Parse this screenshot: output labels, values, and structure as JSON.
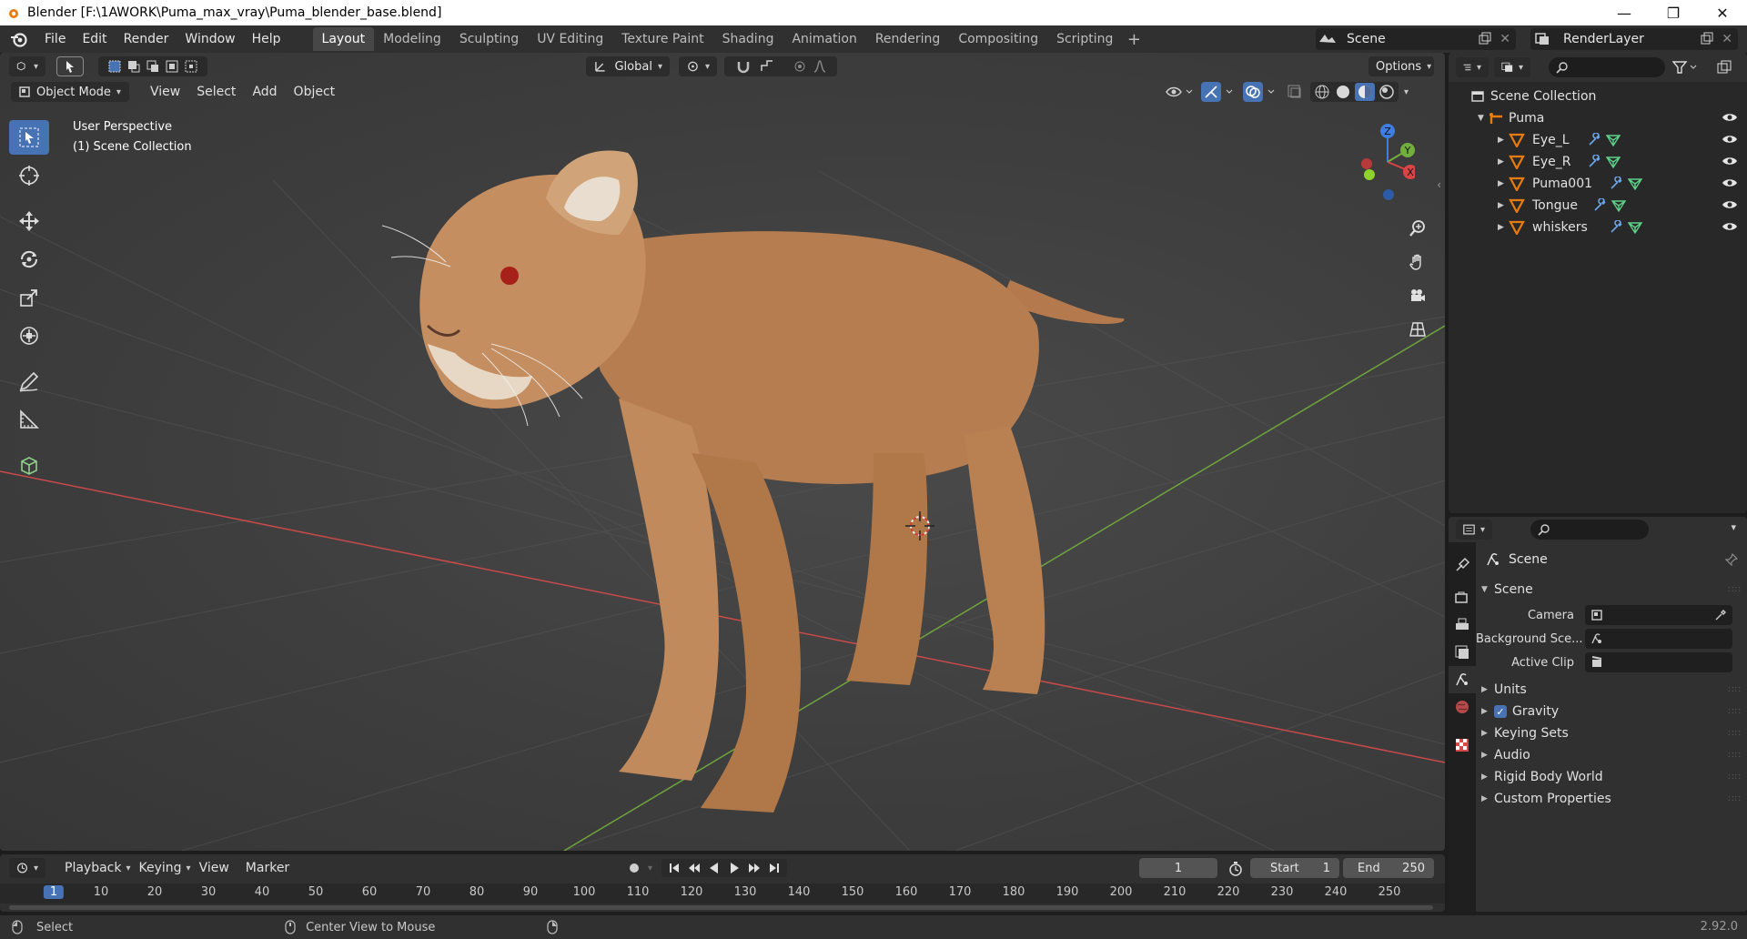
{
  "window": {
    "title": "Blender [F:\\1AWORK\\Puma_max_vray\\Puma_blender_base.blend]",
    "controls": [
      "—",
      "❐",
      "✕"
    ]
  },
  "menu": [
    "File",
    "Edit",
    "Render",
    "Window",
    "Help"
  ],
  "workspaces": {
    "tabs": [
      "Layout",
      "Modeling",
      "Sculpting",
      "UV Editing",
      "Texture Paint",
      "Shading",
      "Animation",
      "Rendering",
      "Compositing",
      "Scripting"
    ],
    "active": "Layout",
    "add": "+"
  },
  "scene_selector": {
    "value": "Scene"
  },
  "view_layer_selector": {
    "value": "RenderLayer"
  },
  "viewport": {
    "transform_orientation": "Global",
    "options_label": "Options",
    "mode": "Object Mode",
    "header_menus": [
      "View",
      "Select",
      "Add",
      "Object"
    ],
    "overlay_line1": "User Perspective",
    "overlay_line2": "(1) Scene Collection",
    "gizmo_axes": {
      "z": "Z",
      "y": "Y",
      "x": "X"
    },
    "colors": {
      "x_axis": "#c84a4a",
      "y_axis": "#6fa43d",
      "active_tool": "#4772b3"
    }
  },
  "timeline": {
    "menus": [
      "Playback",
      "Keying",
      "View",
      "Marker"
    ],
    "current_frame": "1",
    "start_label": "Start",
    "start_value": "1",
    "end_label": "End",
    "end_value": "250",
    "frame_marks": [
      "1",
      "10",
      "20",
      "30",
      "40",
      "50",
      "60",
      "70",
      "80",
      "90",
      "100",
      "110",
      "120",
      "130",
      "140",
      "150",
      "160",
      "170",
      "180",
      "190",
      "200",
      "210",
      "220",
      "230",
      "240",
      "250"
    ]
  },
  "statusbar": {
    "left_action": "Select",
    "middle_action": "Center View to Mouse",
    "version": "2.92.0"
  },
  "outliner": {
    "root": "Scene Collection",
    "collection": "Puma",
    "objects": [
      "Eye_L",
      "Eye_R",
      "Puma001",
      "Tongue",
      "whiskers"
    ]
  },
  "properties": {
    "context_title": "Scene",
    "panel_title": "Scene",
    "camera_label": "Camera",
    "background_scene_label": "Background Sce...",
    "active_clip_label": "Active Clip",
    "subpanels": [
      "Units",
      "Gravity",
      "Keying Sets",
      "Audio",
      "Rigid Body World",
      "Custom Properties"
    ],
    "gravity_checked": true
  }
}
